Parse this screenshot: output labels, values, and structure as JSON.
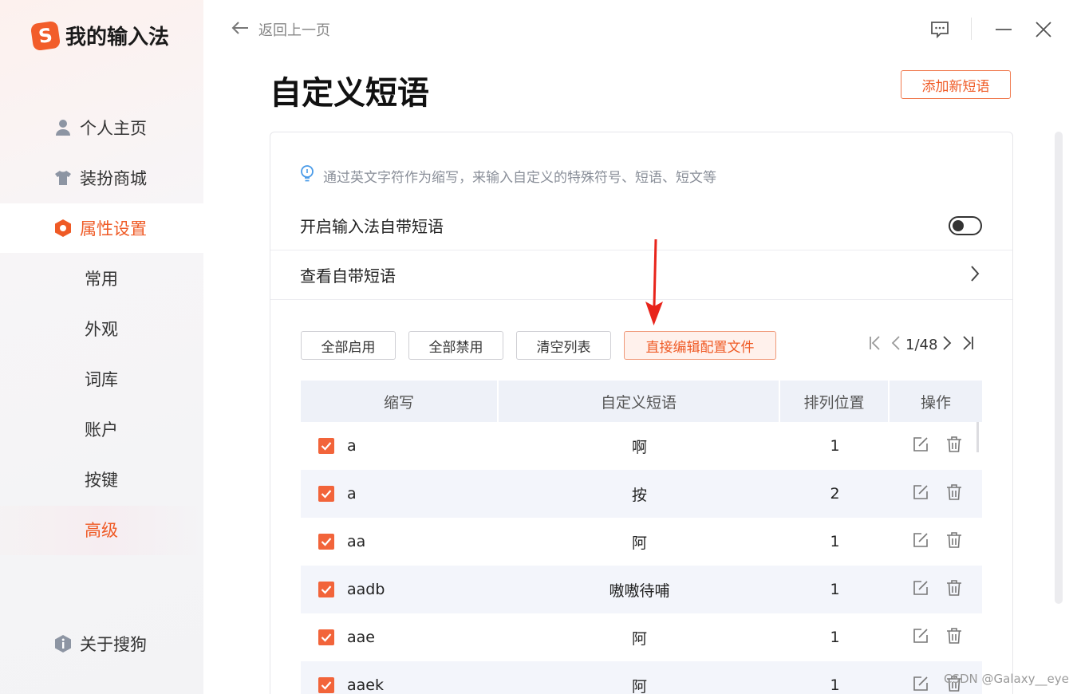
{
  "app": {
    "logo_letter": "S",
    "name": "我的输入法"
  },
  "sidebar": {
    "items": [
      {
        "label": "个人主页",
        "icon": "user-icon"
      },
      {
        "label": "装扮商城",
        "icon": "shirt-icon"
      },
      {
        "label": "属性设置",
        "icon": "hexagon-settings-icon",
        "active": true
      }
    ],
    "sub_items": [
      {
        "label": "常用"
      },
      {
        "label": "外观"
      },
      {
        "label": "词库"
      },
      {
        "label": "账户"
      },
      {
        "label": "按键"
      },
      {
        "label": "高级",
        "active": true
      }
    ],
    "about": {
      "label": "关于搜狗",
      "icon": "info-shield-icon"
    }
  },
  "header": {
    "back_label": "返回上一页",
    "controls": [
      "feedback-icon",
      "minimize-icon",
      "close-icon"
    ]
  },
  "page": {
    "title": "自定义短语",
    "add_button": "添加新短语",
    "tip": "通过英文字符作为缩写，来输入自定义的特殊符号、短语、短文等",
    "enable_label": "开启输入法自带短语",
    "enable_toggle": false,
    "view_builtin_label": "查看自带短语",
    "buttons": {
      "enable_all": "全部启用",
      "disable_all": "全部禁用",
      "clear_list": "清空列表",
      "edit_config": "直接编辑配置文件"
    },
    "pager": {
      "text": "1/48"
    },
    "table": {
      "headers": [
        "缩写",
        "自定义短语",
        "排列位置",
        "操作"
      ],
      "rows": [
        {
          "abbr": "a",
          "phrase": "啊",
          "pos": "1",
          "checked": true
        },
        {
          "abbr": "a",
          "phrase": "按",
          "pos": "2",
          "checked": true
        },
        {
          "abbr": "aa",
          "phrase": "阿",
          "pos": "1",
          "checked": true
        },
        {
          "abbr": "aadb",
          "phrase": "嗷嗷待哺",
          "pos": "1",
          "checked": true
        },
        {
          "abbr": "aae",
          "phrase": "阿",
          "pos": "1",
          "checked": true
        },
        {
          "abbr": "aaek",
          "phrase": "阿",
          "pos": "1",
          "checked": true
        }
      ]
    }
  },
  "watermark": "CSDN @Galaxy__eye",
  "colors": {
    "accent": "#ef5a25",
    "checkbox": "#f2643a",
    "table_header": "#eef1f8",
    "row_alt": "#f3f5fb",
    "annotation": "#e8241b"
  }
}
